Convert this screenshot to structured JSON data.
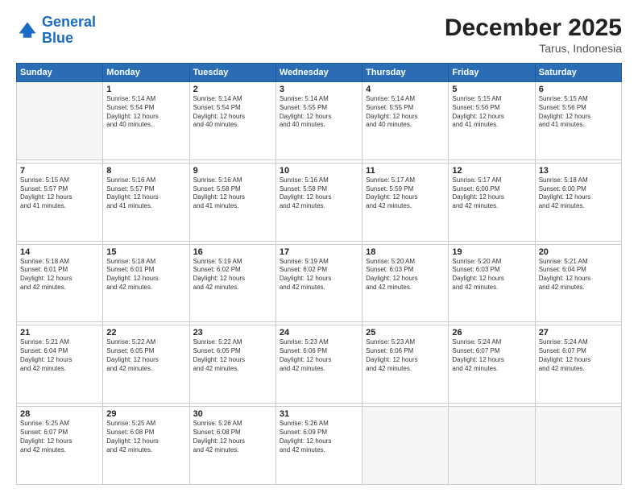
{
  "logo": {
    "line1": "General",
    "line2": "Blue"
  },
  "title": "December 2025",
  "subtitle": "Tarus, Indonesia",
  "days_header": [
    "Sunday",
    "Monday",
    "Tuesday",
    "Wednesday",
    "Thursday",
    "Friday",
    "Saturday"
  ],
  "weeks": [
    [
      {
        "day": "",
        "info": ""
      },
      {
        "day": "1",
        "info": "Sunrise: 5:14 AM\nSunset: 5:54 PM\nDaylight: 12 hours\nand 40 minutes."
      },
      {
        "day": "2",
        "info": "Sunrise: 5:14 AM\nSunset: 5:54 PM\nDaylight: 12 hours\nand 40 minutes."
      },
      {
        "day": "3",
        "info": "Sunrise: 5:14 AM\nSunset: 5:55 PM\nDaylight: 12 hours\nand 40 minutes."
      },
      {
        "day": "4",
        "info": "Sunrise: 5:14 AM\nSunset: 5:55 PM\nDaylight: 12 hours\nand 40 minutes."
      },
      {
        "day": "5",
        "info": "Sunrise: 5:15 AM\nSunset: 5:56 PM\nDaylight: 12 hours\nand 41 minutes."
      },
      {
        "day": "6",
        "info": "Sunrise: 5:15 AM\nSunset: 5:56 PM\nDaylight: 12 hours\nand 41 minutes."
      }
    ],
    [
      {
        "day": "7",
        "info": "Sunrise: 5:15 AM\nSunset: 5:57 PM\nDaylight: 12 hours\nand 41 minutes."
      },
      {
        "day": "8",
        "info": "Sunrise: 5:16 AM\nSunset: 5:57 PM\nDaylight: 12 hours\nand 41 minutes."
      },
      {
        "day": "9",
        "info": "Sunrise: 5:16 AM\nSunset: 5:58 PM\nDaylight: 12 hours\nand 41 minutes."
      },
      {
        "day": "10",
        "info": "Sunrise: 5:16 AM\nSunset: 5:58 PM\nDaylight: 12 hours\nand 42 minutes."
      },
      {
        "day": "11",
        "info": "Sunrise: 5:17 AM\nSunset: 5:59 PM\nDaylight: 12 hours\nand 42 minutes."
      },
      {
        "day": "12",
        "info": "Sunrise: 5:17 AM\nSunset: 6:00 PM\nDaylight: 12 hours\nand 42 minutes."
      },
      {
        "day": "13",
        "info": "Sunrise: 5:18 AM\nSunset: 6:00 PM\nDaylight: 12 hours\nand 42 minutes."
      }
    ],
    [
      {
        "day": "14",
        "info": "Sunrise: 5:18 AM\nSunset: 6:01 PM\nDaylight: 12 hours\nand 42 minutes."
      },
      {
        "day": "15",
        "info": "Sunrise: 5:18 AM\nSunset: 6:01 PM\nDaylight: 12 hours\nand 42 minutes."
      },
      {
        "day": "16",
        "info": "Sunrise: 5:19 AM\nSunset: 6:02 PM\nDaylight: 12 hours\nand 42 minutes."
      },
      {
        "day": "17",
        "info": "Sunrise: 5:19 AM\nSunset: 6:02 PM\nDaylight: 12 hours\nand 42 minutes."
      },
      {
        "day": "18",
        "info": "Sunrise: 5:20 AM\nSunset: 6:03 PM\nDaylight: 12 hours\nand 42 minutes."
      },
      {
        "day": "19",
        "info": "Sunrise: 5:20 AM\nSunset: 6:03 PM\nDaylight: 12 hours\nand 42 minutes."
      },
      {
        "day": "20",
        "info": "Sunrise: 5:21 AM\nSunset: 6:04 PM\nDaylight: 12 hours\nand 42 minutes."
      }
    ],
    [
      {
        "day": "21",
        "info": "Sunrise: 5:21 AM\nSunset: 6:04 PM\nDaylight: 12 hours\nand 42 minutes."
      },
      {
        "day": "22",
        "info": "Sunrise: 5:22 AM\nSunset: 6:05 PM\nDaylight: 12 hours\nand 42 minutes."
      },
      {
        "day": "23",
        "info": "Sunrise: 5:22 AM\nSunset: 6:05 PM\nDaylight: 12 hours\nand 42 minutes."
      },
      {
        "day": "24",
        "info": "Sunrise: 5:23 AM\nSunset: 6:06 PM\nDaylight: 12 hours\nand 42 minutes."
      },
      {
        "day": "25",
        "info": "Sunrise: 5:23 AM\nSunset: 6:06 PM\nDaylight: 12 hours\nand 42 minutes."
      },
      {
        "day": "26",
        "info": "Sunrise: 5:24 AM\nSunset: 6:07 PM\nDaylight: 12 hours\nand 42 minutes."
      },
      {
        "day": "27",
        "info": "Sunrise: 5:24 AM\nSunset: 6:07 PM\nDaylight: 12 hours\nand 42 minutes."
      }
    ],
    [
      {
        "day": "28",
        "info": "Sunrise: 5:25 AM\nSunset: 6:07 PM\nDaylight: 12 hours\nand 42 minutes."
      },
      {
        "day": "29",
        "info": "Sunrise: 5:25 AM\nSunset: 6:08 PM\nDaylight: 12 hours\nand 42 minutes."
      },
      {
        "day": "30",
        "info": "Sunrise: 5:26 AM\nSunset: 6:08 PM\nDaylight: 12 hours\nand 42 minutes."
      },
      {
        "day": "31",
        "info": "Sunrise: 5:26 AM\nSunset: 6:09 PM\nDaylight: 12 hours\nand 42 minutes."
      },
      {
        "day": "",
        "info": ""
      },
      {
        "day": "",
        "info": ""
      },
      {
        "day": "",
        "info": ""
      }
    ]
  ]
}
